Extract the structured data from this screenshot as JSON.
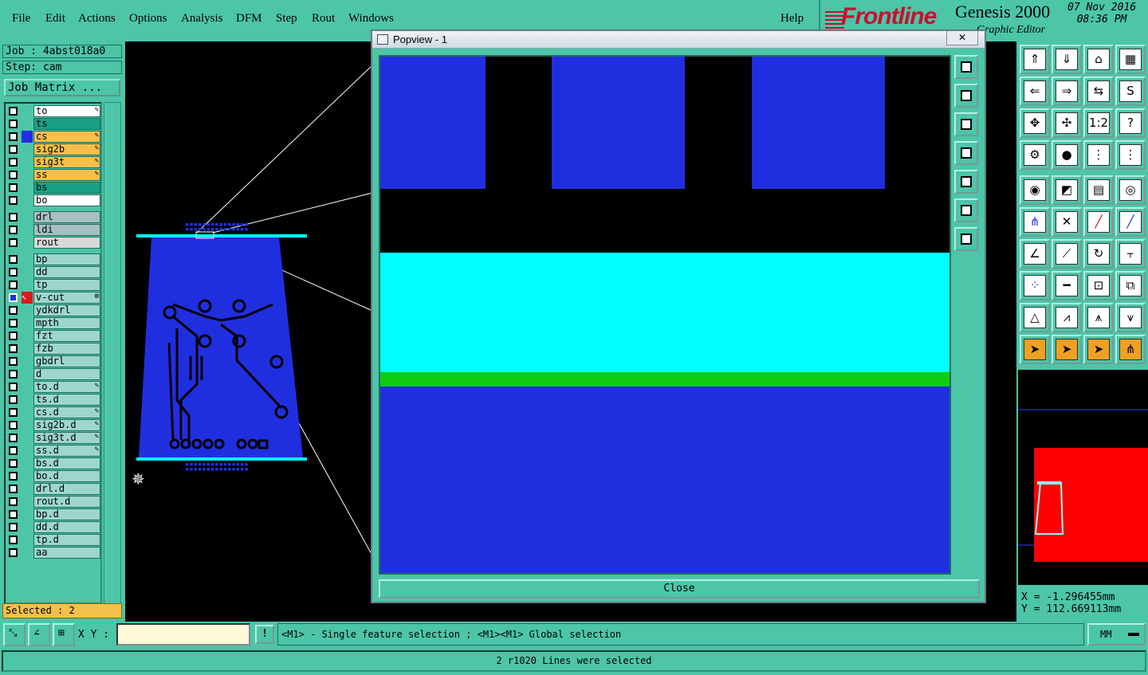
{
  "menu": {
    "items": [
      "File",
      "Edit",
      "Actions",
      "Options",
      "Analysis",
      "DFM",
      "Step",
      "Rout",
      "Windows"
    ],
    "help": "Help"
  },
  "brand": {
    "logo": "Frontline",
    "product": "Genesis 2000",
    "subtitle": "Graphic Editor",
    "date": "07 Nov 2016",
    "time": "08:36 PM",
    "logo_color": "#c8102e"
  },
  "job": {
    "job_label": "Job : 4abst018a0",
    "step_label": "Step: cam",
    "matrix_button": "Job Matrix ..."
  },
  "layers": [
    {
      "name": "to",
      "bg": "#ffffff",
      "flag": "✎"
    },
    {
      "name": "ts",
      "bg": "#1aa085",
      "flag": ""
    },
    {
      "name": "cs",
      "bg": "#f5c04a",
      "flag": "✎",
      "swatch": "#1f2fe0"
    },
    {
      "name": "sig2b",
      "bg": "#f5c04a",
      "flag": "✎"
    },
    {
      "name": "sig3t",
      "bg": "#f5c04a",
      "flag": "✎"
    },
    {
      "name": "ss",
      "bg": "#f5c04a",
      "flag": "✎"
    },
    {
      "name": "bs",
      "bg": "#1aa085",
      "flag": ""
    },
    {
      "name": "bo",
      "bg": "#ffffff",
      "flag": ""
    },
    {
      "name": "drl",
      "bg": "#a8bfc0",
      "flag": "",
      "gap": true
    },
    {
      "name": "ldi",
      "bg": "#a8bfc0",
      "flag": ""
    },
    {
      "name": "rout",
      "bg": "#d8d8d8",
      "flag": ""
    },
    {
      "name": "bp",
      "bg": "#9cd6cc",
      "flag": "",
      "gap": true
    },
    {
      "name": "dd",
      "bg": "#9cd6cc",
      "flag": ""
    },
    {
      "name": "tp",
      "bg": "#9cd6cc",
      "flag": ""
    },
    {
      "name": "v-cut",
      "bg": "#9cd6cc",
      "flag": "⊞",
      "work": true
    },
    {
      "name": "ydkdrl",
      "bg": "#9cd6cc",
      "flag": ""
    },
    {
      "name": "mpth",
      "bg": "#9cd6cc",
      "flag": ""
    },
    {
      "name": "fzt",
      "bg": "#9cd6cc",
      "flag": ""
    },
    {
      "name": "fzb",
      "bg": "#9cd6cc",
      "flag": ""
    },
    {
      "name": "gbdrl",
      "bg": "#9cd6cc",
      "flag": ""
    },
    {
      "name": "d",
      "bg": "#9cd6cc",
      "flag": ""
    },
    {
      "name": "to.d",
      "bg": "#9cd6cc",
      "flag": "✎"
    },
    {
      "name": "ts.d",
      "bg": "#9cd6cc",
      "flag": ""
    },
    {
      "name": "cs.d",
      "bg": "#9cd6cc",
      "flag": "✎"
    },
    {
      "name": "sig2b.d",
      "bg": "#9cd6cc",
      "flag": "✎"
    },
    {
      "name": "sig3t.d",
      "bg": "#9cd6cc",
      "flag": "✎"
    },
    {
      "name": "ss.d",
      "bg": "#9cd6cc",
      "flag": "✎"
    },
    {
      "name": "bs.d",
      "bg": "#9cd6cc",
      "flag": ""
    },
    {
      "name": "bo.d",
      "bg": "#9cd6cc",
      "flag": ""
    },
    {
      "name": "drl.d",
      "bg": "#9cd6cc",
      "flag": ""
    },
    {
      "name": "rout.d",
      "bg": "#9cd6cc",
      "flag": ""
    },
    {
      "name": "bp.d",
      "bg": "#9cd6cc",
      "flag": ""
    },
    {
      "name": "dd.d",
      "bg": "#9cd6cc",
      "flag": ""
    },
    {
      "name": "tp.d",
      "bg": "#9cd6cc",
      "flag": ""
    },
    {
      "name": "aa",
      "bg": "#9cd6cc",
      "flag": ""
    }
  ],
  "selected_label": "Selected : 2",
  "popup": {
    "title": "Popview - 1",
    "close_label": "Close",
    "side_icons": [
      "zoom-home-icon",
      "pan-up-icon",
      "pan-down-icon",
      "pan-left-icon",
      "pan-right-icon",
      "zoom-in-icon",
      "zoom-out-icon"
    ]
  },
  "tools": {
    "rows": [
      [
        "pan-up-icon",
        "pan-down-icon",
        "home-icon",
        "window-icon"
      ],
      [
        "pan-left-icon",
        "pan-right-icon",
        "swap-icon",
        "s-curve-icon"
      ],
      [
        "zoom-in-icon",
        "zoom-out-icon",
        "scale-1-2-icon",
        "help-icon"
      ],
      [
        "measure-tool-icon",
        "pin-icon",
        "layers-a-icon",
        "layers-b-icon"
      ],
      [
        "pad-icon",
        "polygon-icon",
        "ruler-icon",
        "target-icon"
      ],
      [
        "connect-icon",
        "cross-icon",
        "line-red-icon",
        "line-blue-icon"
      ],
      [
        "angle-icon",
        "slash-icon",
        "rotate-icon",
        "mirror-icon"
      ],
      [
        "dots-icon",
        "bar-icon",
        "centre-icon",
        "shapes-icon"
      ],
      [
        "arc-a-icon",
        "arc-b-icon",
        "arc-c-icon",
        "arc-d-icon"
      ],
      [
        "select-arrow-icon",
        "select-box-icon",
        "select-circle-icon",
        "select-net-icon"
      ]
    ],
    "glyphs": {
      "pan-up-icon": "⇑",
      "pan-down-icon": "⇓",
      "home-icon": "⌂",
      "window-icon": "▦",
      "pan-left-icon": "⇐",
      "pan-right-icon": "⇒",
      "swap-icon": "⇆",
      "s-curve-icon": "S",
      "zoom-in-icon": "✥",
      "zoom-out-icon": "✣",
      "scale-1-2-icon": "1:2",
      "help-icon": "?",
      "measure-tool-icon": "⚙",
      "pin-icon": "●",
      "layers-a-icon": "⋮",
      "layers-b-icon": "⋮",
      "pad-icon": "◉",
      "polygon-icon": "◩",
      "ruler-icon": "▤",
      "target-icon": "◎",
      "connect-icon": "⋔",
      "cross-icon": "✕",
      "line-red-icon": "╱",
      "line-blue-icon": "╱",
      "angle-icon": "∠",
      "slash-icon": "⟋",
      "rotate-icon": "↻",
      "mirror-icon": "⫟",
      "dots-icon": "⁘",
      "bar-icon": "━",
      "centre-icon": "⊡",
      "shapes-icon": "⧉",
      "arc-a-icon": "△",
      "arc-b-icon": "⩘",
      "arc-c-icon": "⩚",
      "arc-d-icon": "⩛",
      "select-arrow-icon": "➤",
      "select-box-icon": "➤",
      "select-circle-icon": "➤",
      "select-net-icon": "⋔"
    }
  },
  "coords": {
    "x": "X = -1.296455mm",
    "y": "Y = 112.669113mm"
  },
  "bottom": {
    "xy_label": "X Y :",
    "xy_value": "",
    "hint": "<M1> - Single feature selection ; <M1><M1> Global selection",
    "units": "MM",
    "status": "2 r1020 Lines were selected"
  },
  "colors": {
    "panel": "#4cc5a9",
    "board_blue": "#1f2fe0",
    "cyan": "#00ffff",
    "green": "#10cc10",
    "red": "#ff0000"
  }
}
